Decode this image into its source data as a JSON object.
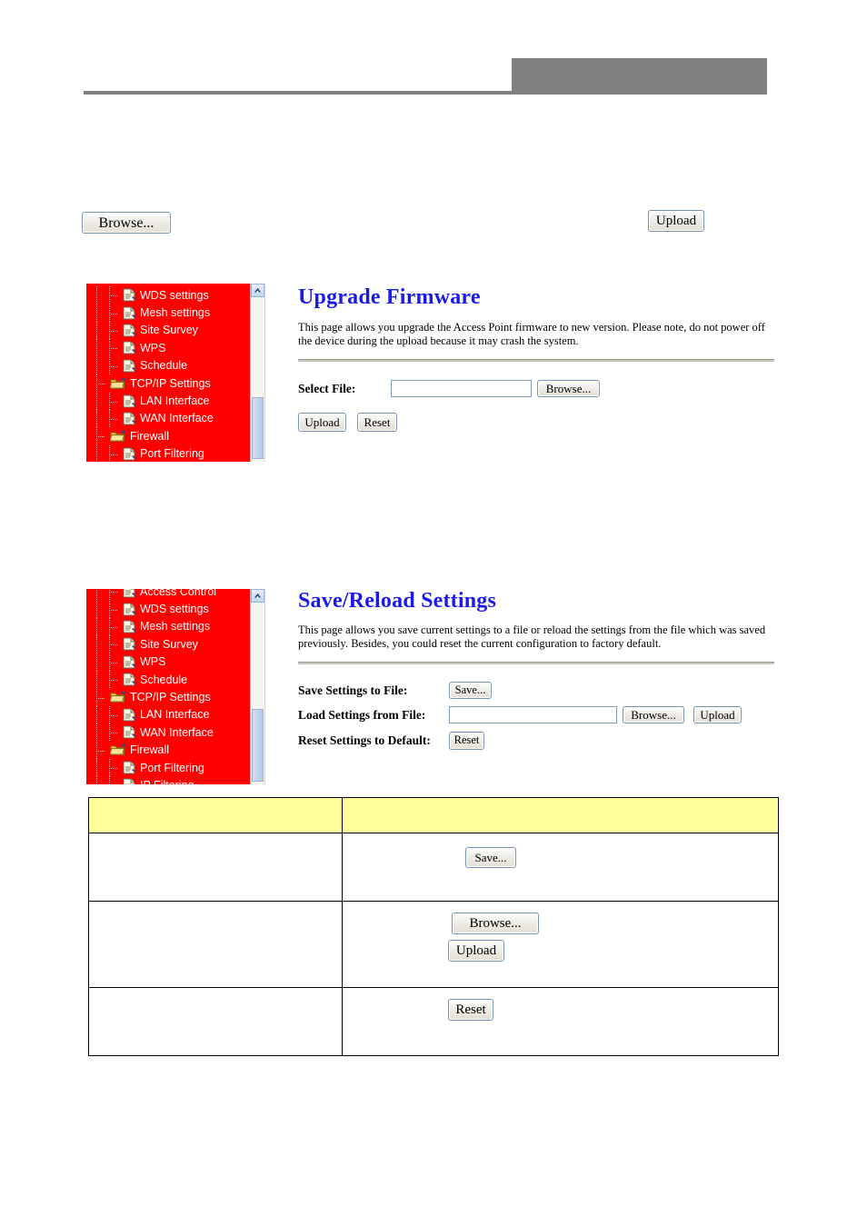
{
  "page": {
    "header_band_color": "#808080",
    "accent_blue": "#1a1aee",
    "nav_red": "#ff0000",
    "table_header_yellow": "#ffff99"
  },
  "top_controls": {
    "browse_label": "Browse...",
    "upload_label": "Upload"
  },
  "screenshots": [
    {
      "id": "upgrade-firmware",
      "title": "Upgrade Firmware",
      "description": "This page allows you upgrade the Access Point firmware to new version. Please note, do not power off the device during the upload because it may crash the system.",
      "nav_items": [
        {
          "label": "WDS settings",
          "level": 2,
          "icon": "page-icon"
        },
        {
          "label": "Mesh settings",
          "level": 2,
          "icon": "page-icon"
        },
        {
          "label": "Site Survey",
          "level": 2,
          "icon": "page-icon"
        },
        {
          "label": "WPS",
          "level": 2,
          "icon": "page-icon"
        },
        {
          "label": "Schedule",
          "level": 2,
          "icon": "page-icon"
        },
        {
          "label": "TCP/IP Settings",
          "level": 1,
          "icon": "folder-icon"
        },
        {
          "label": "LAN Interface",
          "level": 2,
          "icon": "page-icon"
        },
        {
          "label": "WAN Interface",
          "level": 2,
          "icon": "page-icon"
        },
        {
          "label": "Firewall",
          "level": 1,
          "icon": "folder-icon"
        },
        {
          "label": "Port Filtering",
          "level": 2,
          "icon": "page-icon"
        }
      ],
      "fields": {
        "select_file_label": "Select File:",
        "select_file_value": "",
        "select_file_placeholder": "",
        "browse_label": "Browse...",
        "upload_label": "Upload",
        "reset_label": "Reset"
      }
    },
    {
      "id": "save-reload-settings",
      "title": "Save/Reload Settings",
      "description": "This page allows you save current settings to a file or reload the settings from the file which was saved previously. Besides, you could reset the current configuration to factory default.",
      "nav_items": [
        {
          "label": "Access Control",
          "level": 2,
          "icon": "page-icon"
        },
        {
          "label": "WDS settings",
          "level": 2,
          "icon": "page-icon"
        },
        {
          "label": "Mesh settings",
          "level": 2,
          "icon": "page-icon"
        },
        {
          "label": "Site Survey",
          "level": 2,
          "icon": "page-icon"
        },
        {
          "label": "WPS",
          "level": 2,
          "icon": "page-icon"
        },
        {
          "label": "Schedule",
          "level": 2,
          "icon": "page-icon"
        },
        {
          "label": "TCP/IP Settings",
          "level": 1,
          "icon": "folder-icon"
        },
        {
          "label": "LAN Interface",
          "level": 2,
          "icon": "page-icon"
        },
        {
          "label": "WAN Interface",
          "level": 2,
          "icon": "page-icon"
        },
        {
          "label": "Firewall",
          "level": 1,
          "icon": "folder-icon"
        },
        {
          "label": "Port Filtering",
          "level": 2,
          "icon": "page-icon"
        },
        {
          "label": "IP Filtering",
          "level": 2,
          "icon": "page-icon"
        }
      ],
      "fields": {
        "save_settings_label": "Save Settings to File:",
        "save_label": "Save...",
        "load_settings_label": "Load Settings from File:",
        "load_value": "",
        "load_placeholder": "",
        "browse_label": "Browse...",
        "upload_label": "Upload",
        "reset_settings_label": "Reset Settings to Default:",
        "reset_label": "Reset"
      }
    }
  ],
  "description_table": {
    "header": {
      "col_a": "",
      "col_b": ""
    },
    "rows": [
      {
        "col_a": "",
        "buttons": [
          "Save..."
        ]
      },
      {
        "col_a": "",
        "buttons": [
          "Browse...",
          "Upload"
        ]
      },
      {
        "col_a": "",
        "buttons": [
          "Reset"
        ]
      }
    ]
  }
}
